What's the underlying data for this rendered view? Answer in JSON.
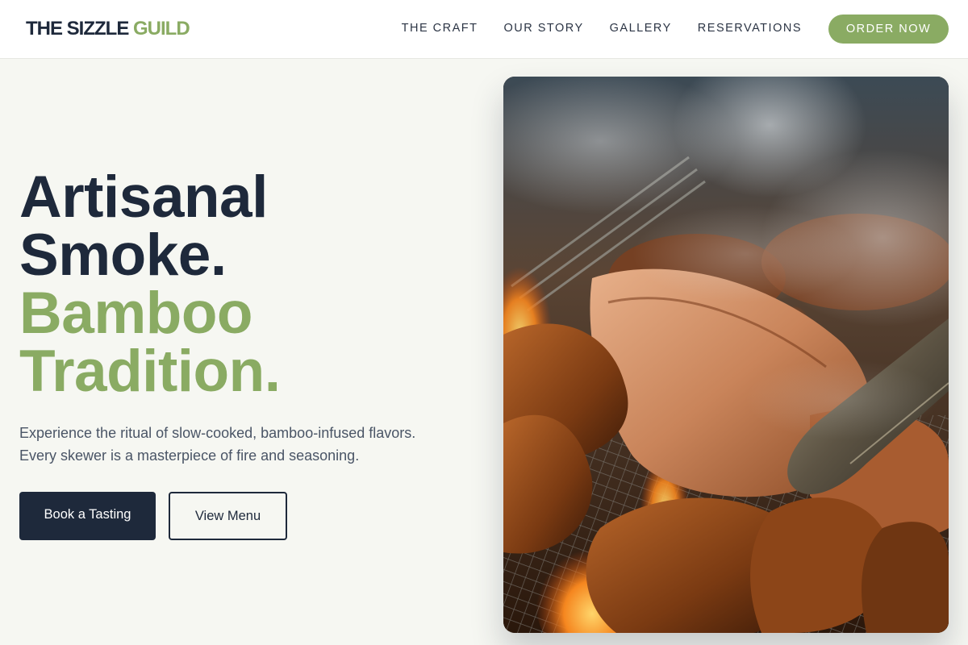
{
  "brand": {
    "name_main": "THE SIZZLE",
    "name_accent": "GUILD"
  },
  "nav": {
    "items": [
      {
        "label": "THE CRAFT"
      },
      {
        "label": "OUR STORY"
      },
      {
        "label": "GALLERY"
      },
      {
        "label": "RESERVATIONS"
      }
    ],
    "cta_label": "ORDER NOW"
  },
  "hero": {
    "headline": [
      "Artisanal",
      "Smoke.",
      "Bamboo",
      "Tradition."
    ],
    "description": [
      "Experience the ritual of slow-cooked, bamboo-infused flavors.",
      "Every skewer is a masterpiece of fire and seasoning."
    ],
    "primary_button": "Book a Tasting",
    "secondary_button": "View Menu",
    "image_alt": "grilled-meat-photo"
  },
  "colors": {
    "accent": "#8aab63",
    "dark": "#1e293b",
    "background": "#f6f7f2"
  }
}
